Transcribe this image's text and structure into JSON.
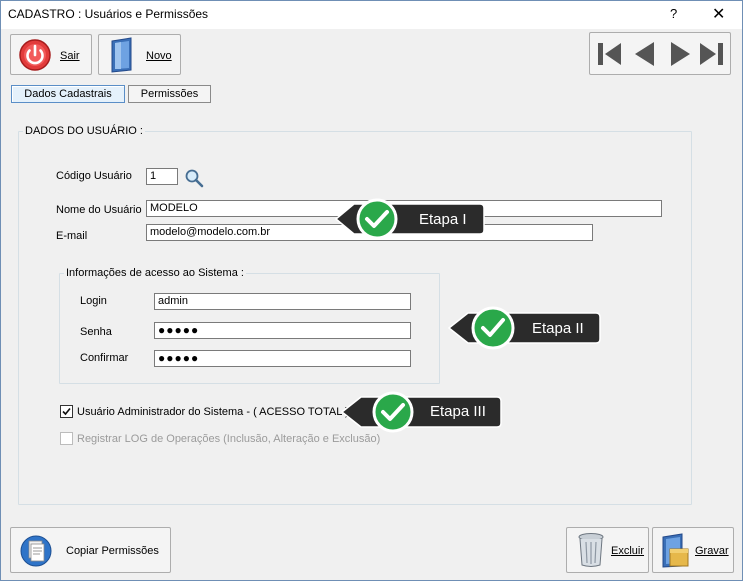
{
  "window": {
    "title": "CADASTRO : Usuários e Permissões",
    "help": "?",
    "close": "✕"
  },
  "toolbar": {
    "sair": "Sair",
    "novo": "Novo"
  },
  "tabs": [
    {
      "label": "Dados Cadastrais",
      "active": true
    },
    {
      "label": "Permissões",
      "active": false
    }
  ],
  "user_group": {
    "title": "DADOS DO USUÁRIO :",
    "codigo_label": "Código Usuário",
    "codigo_value": "1",
    "nome_label": "Nome do Usuário",
    "nome_value": "MODELO",
    "email_label": "E-mail",
    "email_value": "modelo@modelo.com.br"
  },
  "access_group": {
    "title": "Informações de acesso ao Sistema :",
    "login_label": "Login",
    "login_value": "admin",
    "senha_label": "Senha",
    "senha_value": "●●●●●",
    "confirmar_label": "Confirmar",
    "confirmar_value": "●●●●●"
  },
  "options": {
    "admin_label": "Usuário Administrador do Sistema - ( ACESSO TOTAL )",
    "admin_checked": true,
    "log_label": "Registrar LOG de Operações (Inclusão, Alteração e Exclusão)",
    "log_checked": false
  },
  "callouts": {
    "etapa1": "Etapa I",
    "etapa2": "Etapa II",
    "etapa3": "Etapa III"
  },
  "bottom": {
    "copiar": "Copiar Permissões",
    "excluir": "Excluir",
    "gravar": "Gravar"
  }
}
